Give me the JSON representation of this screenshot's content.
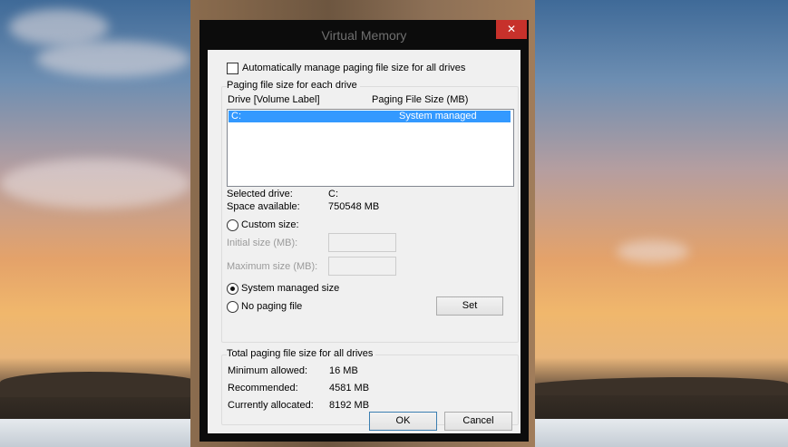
{
  "window": {
    "title": "Virtual Memory",
    "close_glyph": "✕"
  },
  "auto_manage": {
    "label": "Automatically manage paging file size for all drives",
    "checked": false
  },
  "paging_group": {
    "legend": "Paging file size for each drive",
    "col_drive": "Drive  [Volume Label]",
    "col_size": "Paging File Size (MB)",
    "rows": [
      {
        "drive": "C:",
        "size": "System managed"
      }
    ],
    "selected_drive_label": "Selected drive:",
    "selected_drive_value": "C:",
    "space_available_label": "Space available:",
    "space_available_value": "750548 MB",
    "custom_size_label": "Custom size:",
    "initial_size_label": "Initial size (MB):",
    "maximum_size_label": "Maximum size (MB):",
    "system_managed_label": "System managed size",
    "no_paging_label": "No paging file",
    "set_label": "Set",
    "selected_option": "system_managed"
  },
  "total_group": {
    "legend": "Total paging file size for all drives",
    "min_label": "Minimum allowed:",
    "min_value": "16 MB",
    "rec_label": "Recommended:",
    "rec_value": "4581 MB",
    "cur_label": "Currently allocated:",
    "cur_value": "8192 MB"
  },
  "buttons": {
    "ok": "OK",
    "cancel": "Cancel"
  },
  "colors": {
    "selection": "#3399ff",
    "close": "#c7312b",
    "window_frame": "#0c0c0c"
  }
}
